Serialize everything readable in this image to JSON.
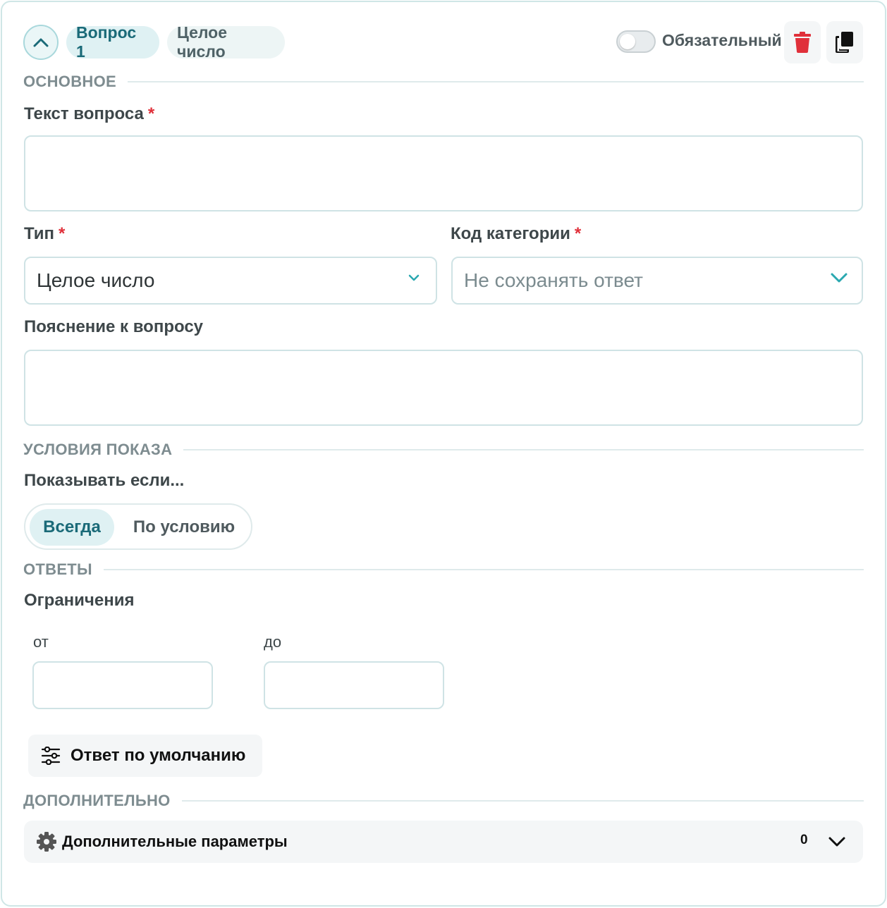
{
  "header": {
    "question_chip": "Вопрос 1",
    "type_chip": "Целое число",
    "required_label": "Обязательный",
    "required_on": false
  },
  "sections": {
    "basic": "ОСНОВНОЕ",
    "conditions": "УСЛОВИЯ ПОКАЗА",
    "answers": "ОТВЕТЫ",
    "additional": "ДОПОЛНИТЕЛЬНО"
  },
  "fields": {
    "question_text_label": "Текст вопроса",
    "question_text_value": "",
    "type_label": "Тип",
    "type_value": "Целое число",
    "category_label": "Код категории",
    "category_placeholder": "Не сохранять ответ",
    "hint_label": "Пояснение к вопросу",
    "hint_value": "",
    "required_mark": "*"
  },
  "conditions": {
    "show_if_label": "Показывать если...",
    "options": [
      "Всегда",
      "По условию"
    ],
    "selected": "Всегда"
  },
  "answers": {
    "limits_label": "Ограничения",
    "from_label": "от",
    "to_label": "до",
    "from_value": "",
    "to_value": "",
    "default_answer_button": "Ответ по умолчанию"
  },
  "additional": {
    "params_label": "Дополнительные параметры",
    "params_count": "0"
  },
  "colors": {
    "accent": "#1a6a78",
    "delete": "#e0303a",
    "required_star": "#e0303a",
    "chevron": "#2aa8b0"
  },
  "icons": {
    "collapse": "chevron-up-icon",
    "delete": "trash-icon",
    "duplicate": "copy-icon",
    "select_arrow": "chevron-down-icon",
    "default_answer": "sliders-icon",
    "params": "gear-icon"
  }
}
